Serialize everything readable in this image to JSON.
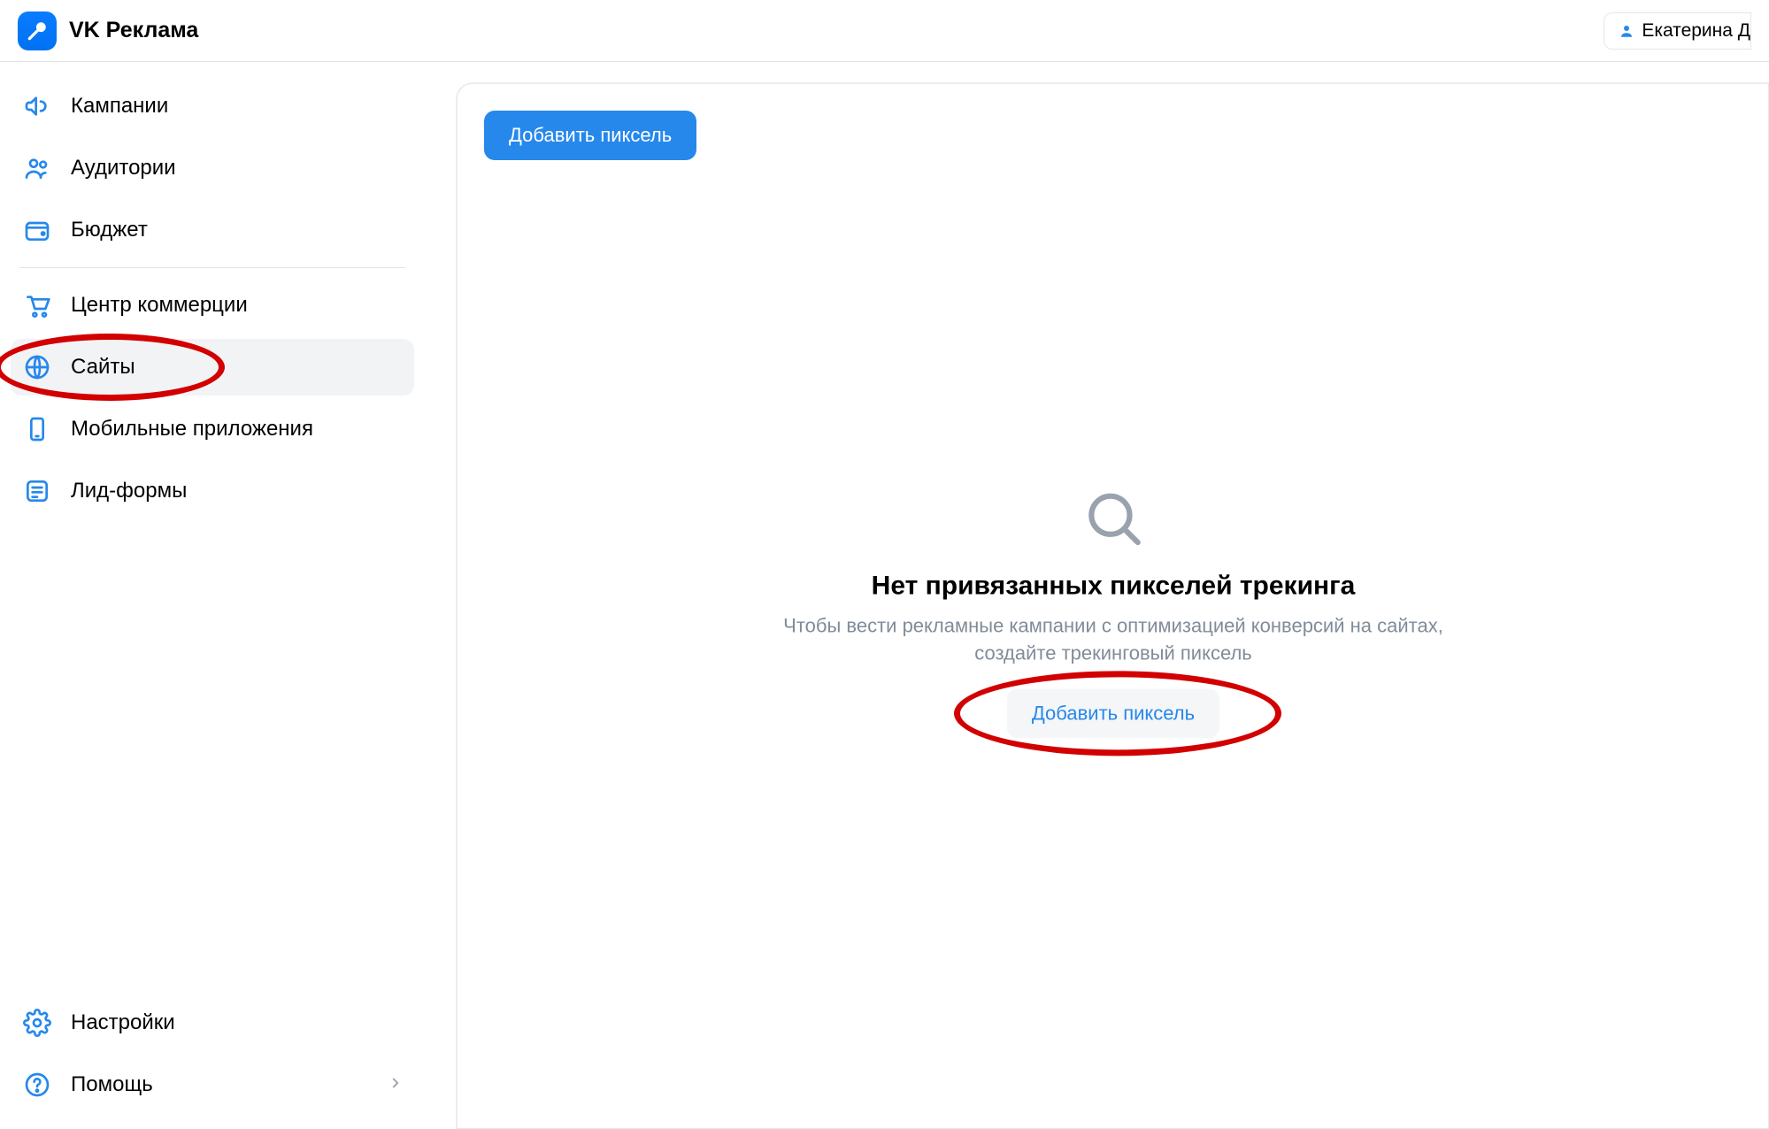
{
  "header": {
    "brand": "VK Реклама",
    "user_name": "Екатерина Д"
  },
  "sidebar": {
    "items": [
      {
        "icon": "megaphone-icon",
        "label": "Кампании"
      },
      {
        "icon": "users-icon",
        "label": "Аудитории"
      },
      {
        "icon": "wallet-icon",
        "label": "Бюджет"
      }
    ],
    "items2": [
      {
        "icon": "cart-icon",
        "label": "Центр коммерции"
      },
      {
        "icon": "globe-icon",
        "label": "Сайты",
        "active": true
      },
      {
        "icon": "mobile-icon",
        "label": "Мобильные приложения"
      },
      {
        "icon": "form-icon",
        "label": "Лид-формы"
      }
    ],
    "footer": [
      {
        "icon": "gear-icon",
        "label": "Настройки"
      },
      {
        "icon": "help-icon",
        "label": "Помощь",
        "has_chevron": true
      }
    ]
  },
  "main": {
    "add_pixel_button": "Добавить пиксель",
    "empty": {
      "title": "Нет привязанных пикселей трекинга",
      "description": "Чтобы вести рекламные кампании с оптимизацией конверсий на сайтах, создайте трекинговый пиксель",
      "cta": "Добавить пиксель"
    }
  },
  "colors": {
    "accent": "#2688eb",
    "annotation": "#d20000",
    "muted": "#818c99"
  }
}
